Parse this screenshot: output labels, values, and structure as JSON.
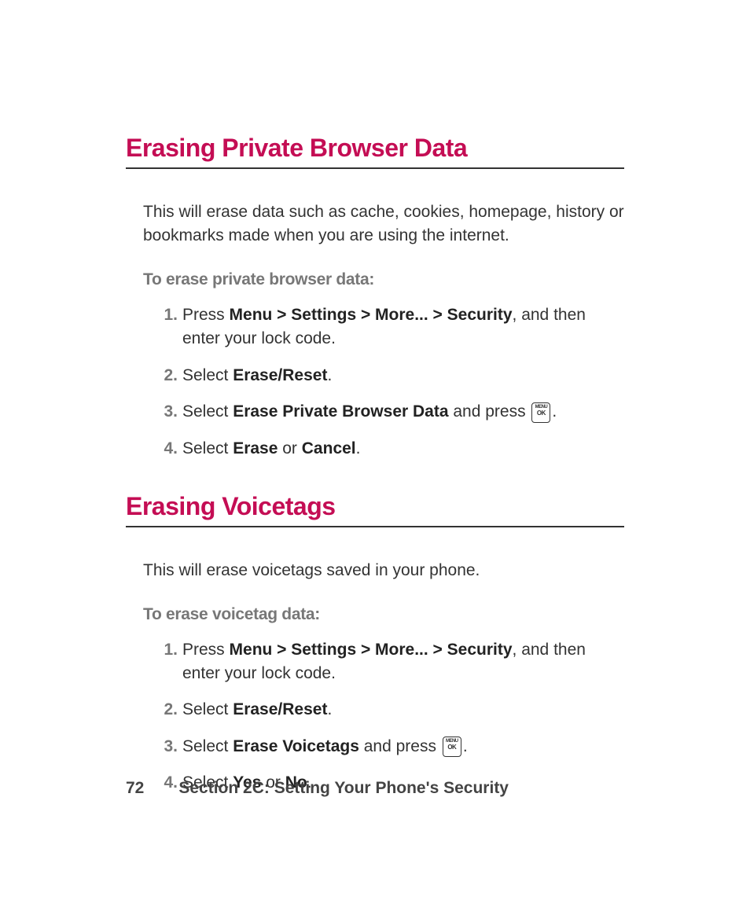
{
  "section1": {
    "heading": "Erasing Private Browser Data",
    "intro": "This will erase data such as cache, cookies, homepage, history or bookmarks made when you are using the internet.",
    "subheading": "To erase private browser data:",
    "steps": {
      "s1_pre": "Press ",
      "s1_bold": "Menu > Settings > More... > Security",
      "s1_post": ", and then enter your lock code.",
      "s2_pre": "Select ",
      "s2_bold": "Erase/Reset",
      "s2_post": ".",
      "s3_pre": "Select ",
      "s3_bold": "Erase Private Browser Data",
      "s3_mid": " and press ",
      "s3_post": ".",
      "s4_pre": "Select ",
      "s4_bold1": "Erase",
      "s4_mid": " or ",
      "s4_bold2": "Cancel",
      "s4_post": "."
    }
  },
  "section2": {
    "heading": "Erasing Voicetags",
    "intro": "This will erase voicetags saved in your phone.",
    "subheading": "To erase voicetag data:",
    "steps": {
      "s1_pre": "Press ",
      "s1_bold": "Menu > Settings > More... > Security",
      "s1_post": ", and then enter your lock code.",
      "s2_pre": "Select ",
      "s2_bold": "Erase/Reset",
      "s2_post": ".",
      "s3_pre": "Select ",
      "s3_bold": "Erase Voicetags",
      "s3_mid": " and press ",
      "s3_post": ".",
      "s4_pre": "Select ",
      "s4_bold1": "Yes",
      "s4_mid": " or ",
      "s4_bold2": "No",
      "s4_post": "."
    }
  },
  "key_icon": {
    "top": "MENU",
    "bot": "OK"
  },
  "footer": {
    "page_number": "72",
    "section_label": "Section 2C: Setting Your Phone's Security"
  }
}
